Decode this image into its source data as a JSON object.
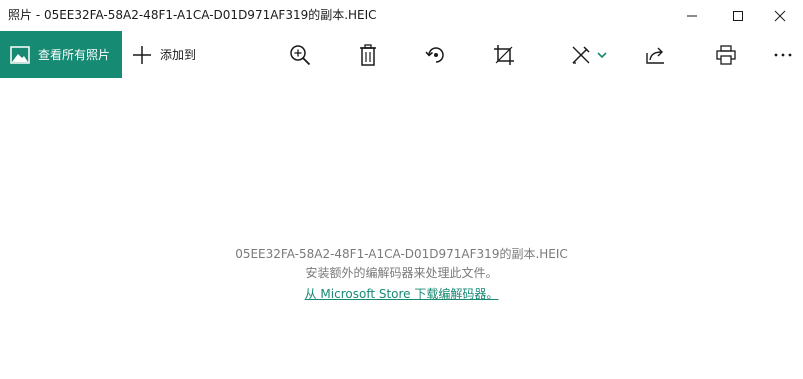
{
  "window": {
    "title": "照片 - 05EE32FA-58A2-48F1-A1CA-D01D971AF319的副本.HEIC"
  },
  "toolbar": {
    "view_all_label": "查看所有照片",
    "add_to_label": "添加到",
    "icons": [
      "zoom-icon",
      "delete-icon",
      "rotate-icon",
      "crop-icon",
      "edit-icon",
      "share-icon",
      "print-icon",
      "more-icon"
    ]
  },
  "message": {
    "filename": "05EE32FA-58A2-48F1-A1CA-D01D971AF319的副本.HEIC",
    "info": "安装额外的编解码器来处理此文件。",
    "link": "从 Microsoft Store 下载编解码器。"
  },
  "colors": {
    "accent": "#178a73",
    "text_secondary": "#7a7a7a"
  }
}
